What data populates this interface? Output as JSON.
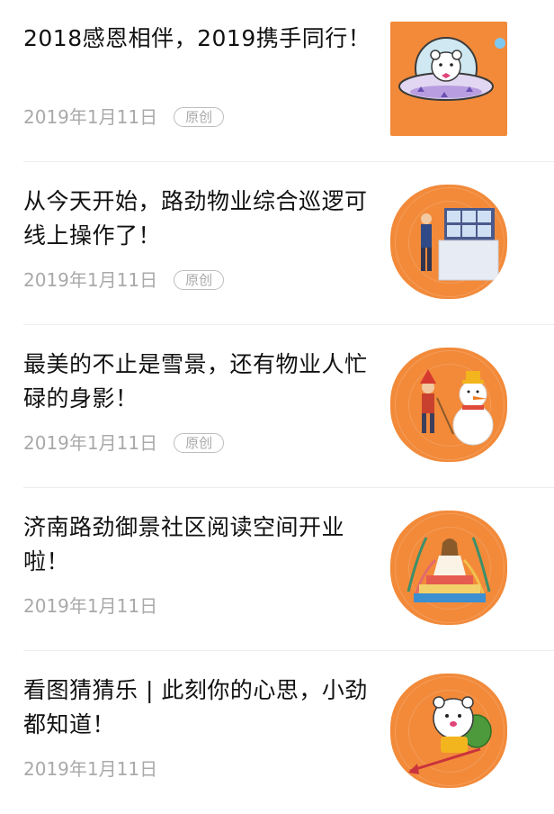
{
  "articles": [
    {
      "title": "2018感恩相伴，2019携手同行！",
      "date": "2019年1月11日",
      "badge": "原创",
      "thumb_icon": "ufo-bear-illustration",
      "thumb_shape": "square"
    },
    {
      "title": "从今天开始，路劲物业综合巡逻可线上操作了！",
      "date": "2019年1月11日",
      "badge": "原创",
      "thumb_icon": "security-monitor-illustration",
      "thumb_shape": "round"
    },
    {
      "title": "最美的不止是雪景，还有物业人忙碌的身影！",
      "date": "2019年1月11日",
      "badge": "原创",
      "thumb_icon": "snowman-sweeper-illustration",
      "thumb_shape": "round"
    },
    {
      "title": "济南路劲御景社区阅读空间开业啦！",
      "date": "2019年1月11日",
      "badge": "",
      "thumb_icon": "reading-girl-illustration",
      "thumb_shape": "round"
    },
    {
      "title": "看图猜猜乐 | 此刻你的心思，小劲都知道！",
      "date": "2019年1月11日",
      "badge": "",
      "thumb_icon": "cupid-bear-illustration",
      "thumb_shape": "round"
    }
  ],
  "colors": {
    "thumb_bg": "#f28a3a",
    "title": "#111111",
    "meta": "#a9a9a9"
  }
}
